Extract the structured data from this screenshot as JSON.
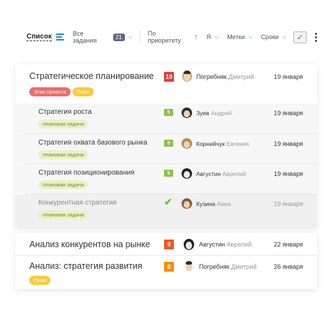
{
  "toolbar": {
    "view_label": "Список",
    "filter_label": "Все задания",
    "filter_count": "21",
    "sort_label": "По приоритету",
    "me_label": "Я",
    "tags_label": "Метки",
    "terms_label": "Сроки"
  },
  "groups": [
    {
      "title": "Стратегическое планирование",
      "priority": "10",
      "priority_color": "#e53935",
      "person_first": "Погребняк",
      "person_last": "Дмитрий",
      "date": "19 января",
      "tags": [
        "Этап проекта",
        "План"
      ],
      "subtasks": [
        {
          "title": "Стратегия роста",
          "priority": "5",
          "person_first": "Зуев",
          "person_last": "Андрей",
          "date": "19 января",
          "tag": "плановая задача",
          "done": false
        },
        {
          "title": "Стратегия охвата базового рынка",
          "priority": "5",
          "person_first": "Корнийчук",
          "person_last": "Евгения",
          "date": "19 января",
          "tag": "плановая задача",
          "done": false
        },
        {
          "title": "Стратегия позиционирования",
          "priority": "5",
          "person_first": "Августин",
          "person_last": "Аврелий",
          "date": "19 января",
          "tag": "плановая задача",
          "done": false
        },
        {
          "title": "Конкурентная стратегия",
          "priority": "",
          "person_first": "Кузина",
          "person_last": "Анна",
          "date": "19 января",
          "tag": "плановая задача",
          "done": true
        }
      ]
    },
    {
      "title": "Анализ конкурентов на рынке",
      "priority": "9",
      "priority_color": "#f4511e",
      "person_first": "Августин",
      "person_last": "Аврелий",
      "date": "22 января",
      "tags": []
    },
    {
      "title": "Анализ: стратегия развития",
      "priority": "8",
      "priority_color": "#fb8c00",
      "person_first": "Погребняк",
      "person_last": "Дмитрий",
      "date": "26 января",
      "tags": [
        "План"
      ]
    }
  ],
  "colors": {
    "accent": "#1e88e5",
    "subtask_priority": "#8bc34a",
    "done_check": "#6abf3a"
  }
}
